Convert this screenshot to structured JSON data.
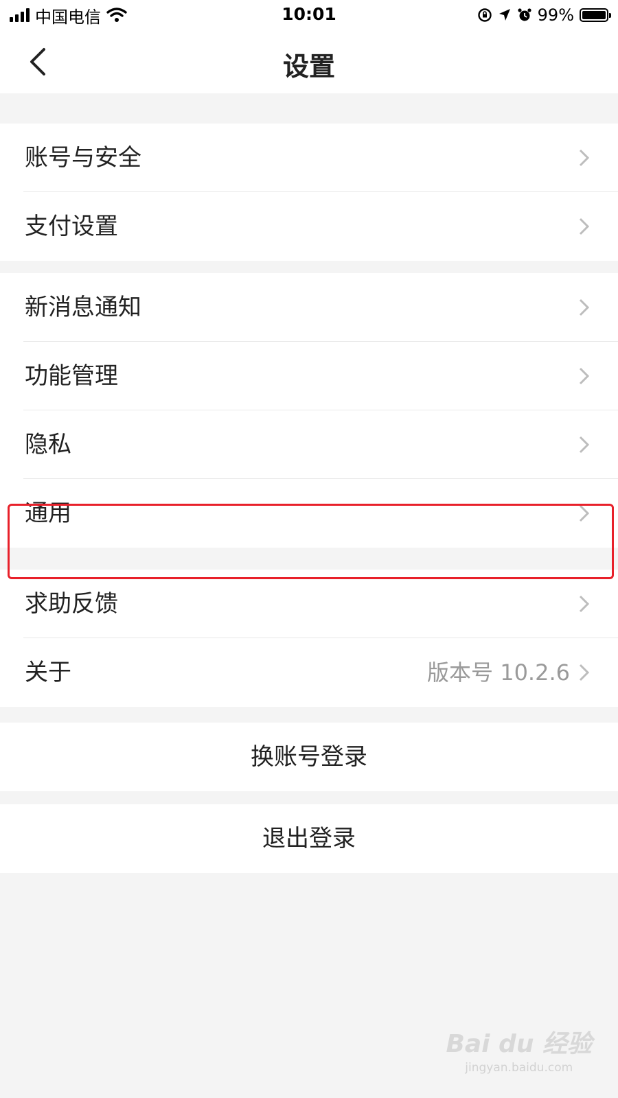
{
  "status_bar": {
    "carrier": "中国电信",
    "time": "10:01",
    "battery_percent": "99%",
    "battery_level": 0.99,
    "icons": [
      "signal-icon",
      "wifi-icon",
      "rotation-lock-icon",
      "location-arrow-icon",
      "alarm-icon",
      "battery-icon"
    ]
  },
  "nav": {
    "title": "设置",
    "back_icon": "chevron-left-icon"
  },
  "group1": [
    {
      "label": "账号与安全"
    },
    {
      "label": "支付设置"
    }
  ],
  "group2": [
    {
      "label": "新消息通知"
    },
    {
      "label": "功能管理"
    },
    {
      "label": "隐私"
    },
    {
      "label": "通用"
    }
  ],
  "group3": [
    {
      "label": "求助反馈"
    },
    {
      "label": "关于",
      "value": "版本号 10.2.6"
    }
  ],
  "actions": {
    "switch_account": "换账号登录",
    "logout": "退出登录"
  },
  "highlight_color": "#e8202a",
  "watermark": {
    "logo": "Bai du 经验",
    "url": "jingyan.baidu.com"
  }
}
